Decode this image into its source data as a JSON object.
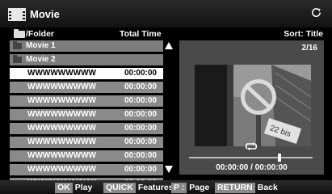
{
  "header": {
    "title": "Movie",
    "film_icon": "film-icon",
    "refresh_icon": "refresh-icon"
  },
  "columns": {
    "folder_label": "/Folder",
    "total_time_label": "Total Time",
    "sort_label": "Sort: Title"
  },
  "list": {
    "folders": [
      {
        "name": "Movie 1"
      },
      {
        "name": "Movie 2"
      }
    ],
    "files": [
      {
        "name": "WWWWWWWWW",
        "time": "00:00:00",
        "selected": true
      },
      {
        "name": "WWWWWWWWW",
        "time": "00:00:00"
      },
      {
        "name": "WWWWWWWWW",
        "time": "00:00:00"
      },
      {
        "name": "WWWWWWWWW",
        "time": "00:00:00"
      },
      {
        "name": "WWWWWWWWW",
        "time": "00:00:00"
      },
      {
        "name": "WWWWWWWWW",
        "time": "00:00:00"
      },
      {
        "name": "WWWWWWWWW",
        "time": "00:00:00"
      },
      {
        "name": "WWWWWWWWW",
        "time": "00:00:00"
      },
      {
        "name": "WWWWWWWWW",
        "time": "00:00:00"
      }
    ]
  },
  "preview": {
    "page": "2/16",
    "sign_text": "22 bis",
    "time_readout": "00:00:00 / 00:00:00",
    "progress": 0.73,
    "repeat_icon": "repeat-icon"
  },
  "footer": {
    "items": [
      {
        "key": "OK",
        "label": "Play"
      },
      {
        "key": "QUICK",
        "label": "Features"
      },
      {
        "key": "P :",
        "label": "Page"
      },
      {
        "key": "RETURN",
        "label": "Back"
      }
    ]
  },
  "colors": {
    "background": "#000000",
    "row_gray": "#8a8a8a",
    "selected_row": "#ffffff",
    "preview_panel": "#4a4a4a"
  }
}
